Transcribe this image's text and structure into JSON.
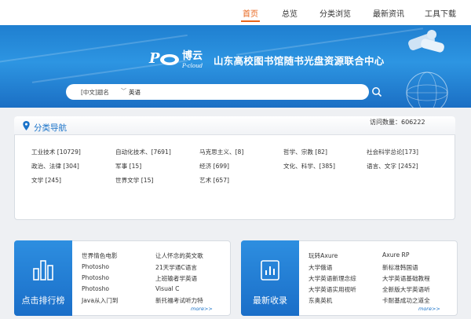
{
  "nav": {
    "items": [
      {
        "label": "首页",
        "active": true
      },
      {
        "label": "总览",
        "active": false
      },
      {
        "label": "分类浏览",
        "active": false
      },
      {
        "label": "最新资讯",
        "active": false
      },
      {
        "label": "工具下载",
        "active": false
      }
    ]
  },
  "banner": {
    "logo_cn": "博云",
    "logo_en": "P-cloud",
    "title": "山东高校图书馆随书光盘资源联合中心"
  },
  "search": {
    "scope": "[中文]题名",
    "value": "英语"
  },
  "category_nav": {
    "title": "分类导航",
    "visits": "访问数量：606222",
    "rows": [
      [
        "工业技术 [10729]",
        "自动化技术、[7691]",
        "马克思主义、[8]",
        "哲学、宗教 [82]",
        "社会科学总论[173]"
      ],
      [
        "政治、法律 [304]",
        "军事 [15]",
        "经济 [699]",
        "文化、科学、[385]",
        "语言、文字 [2452]"
      ],
      [
        "文学 [245]",
        "世界文学 [15]",
        "艺术 [657]"
      ]
    ]
  },
  "panels": {
    "ranking": {
      "label": "点击排行榜",
      "col1": [
        "世界情色电影",
        "Photosho",
        "Photosho",
        "Photosho",
        "Java从入门到"
      ],
      "col2": [
        "让人怀念的英文歌",
        "21天学通C语言",
        "上班输者学英语",
        "Visual C",
        "新托福考试听力特"
      ],
      "more": "more>>"
    },
    "latest": {
      "label": "最新收录",
      "col1": [
        "玩转Axure",
        "大学俄语",
        "大学英语新理念综",
        "大学英语实用视听",
        "东奥英机"
      ],
      "col2": [
        "Axure RP",
        "新标准韩国语",
        "大学英语基础教程",
        "全新版大学英语听",
        "卡耐基成功之道全"
      ],
      "more": "more>>"
    }
  },
  "colors": {
    "accent": "#e8641b",
    "brand_blue": "#1a73c9",
    "banner_blue": "#2d95e2"
  }
}
